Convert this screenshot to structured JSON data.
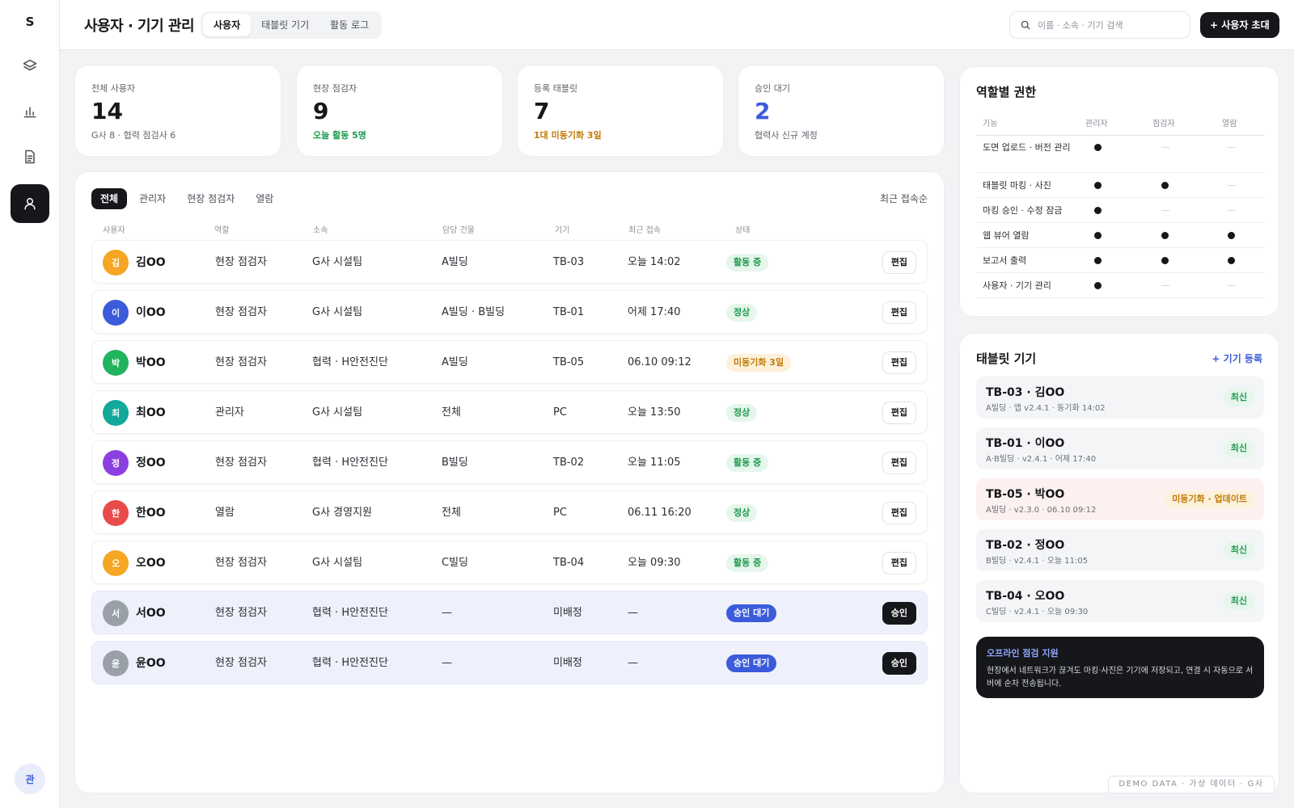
{
  "app": {
    "logo": "S",
    "user_initial": "관"
  },
  "header": {
    "title": "사용자 · 기기 관리",
    "tabs": [
      "사용자",
      "태블릿 기기",
      "활동 로그"
    ],
    "search_placeholder": "이름 · 소속 · 기기 검색",
    "invite_label": "+ 사용자 초대"
  },
  "stats": [
    {
      "label": "전체 사용자",
      "value": "14",
      "sub": "G사 8 · 협력 점검사 6",
      "value_color": "#15171a",
      "sub_color": "#5f646d"
    },
    {
      "label": "현장 점검자",
      "value": "9",
      "sub": "오늘 활동 5명",
      "value_color": "#15171a",
      "sub_color": "#1e9a4d"
    },
    {
      "label": "등록 태블릿",
      "value": "7",
      "sub": "1대 미동기화 3일",
      "value_color": "#15171a",
      "sub_color": "#c27a06"
    },
    {
      "label": "승인 대기",
      "value": "2",
      "sub": "협력사 신규 계정",
      "value_color": "#3b5bdb",
      "sub_color": "#5f646d"
    }
  ],
  "users": {
    "filter_tabs": [
      "전체",
      "관리자",
      "현장 점검자",
      "열람"
    ],
    "sort_label": "최근 접속순",
    "columns": [
      "사용자",
      "역할",
      "소속",
      "담당 건물",
      "기기",
      "최근 접속",
      "상태"
    ],
    "rows": [
      {
        "initial": "김",
        "name": "김OO",
        "role": "현장 점검자",
        "org": "G사 시설팀",
        "building": "A빌딩",
        "device": "TB-03",
        "last": "오늘 14:02",
        "status": "활동 중",
        "status_type": "active",
        "action": "편집",
        "avatar_color": "#f5a623",
        "pending": false
      },
      {
        "initial": "이",
        "name": "이OO",
        "role": "현장 점검자",
        "org": "G사 시설팀",
        "building": "A빌딩 · B빌딩",
        "device": "TB-01",
        "last": "어제 17:40",
        "status": "정상",
        "status_type": "ok",
        "action": "편집",
        "avatar_color": "#3b5bdb",
        "pending": false
      },
      {
        "initial": "박",
        "name": "박OO",
        "role": "현장 점검자",
        "org": "협력 · H안전진단",
        "building": "A빌딩",
        "device": "TB-05",
        "last": "06.10 09:12",
        "status": "미동기화 3일",
        "status_type": "warn",
        "action": "편집",
        "avatar_color": "#22b35e",
        "pending": false
      },
      {
        "initial": "최",
        "name": "최OO",
        "role": "관리자",
        "org": "G사 시설팀",
        "building": "전체",
        "device": "PC",
        "last": "오늘 13:50",
        "status": "정상",
        "status_type": "ok",
        "action": "편집",
        "avatar_color": "#12a89a",
        "pending": false
      },
      {
        "initial": "정",
        "name": "정OO",
        "role": "현장 점검자",
        "org": "협력 · H안전진단",
        "building": "B빌딩",
        "device": "TB-02",
        "last": "오늘 11:05",
        "status": "활동 중",
        "status_type": "active",
        "action": "편집",
        "avatar_color": "#8b3fe0",
        "pending": false
      },
      {
        "initial": "한",
        "name": "한OO",
        "role": "열람",
        "org": "G사 경영지원",
        "building": "전체",
        "device": "PC",
        "last": "06.11 16:20",
        "status": "정상",
        "status_type": "ok",
        "action": "편집",
        "avatar_color": "#e94a4a",
        "pending": false
      },
      {
        "initial": "오",
        "name": "오OO",
        "role": "현장 점검자",
        "org": "G사 시설팀",
        "building": "C빌딩",
        "device": "TB-04",
        "last": "오늘 09:30",
        "status": "활동 중",
        "status_type": "active",
        "action": "편집",
        "avatar_color": "#f5a623",
        "pending": false
      },
      {
        "initial": "서",
        "name": "서OO",
        "role": "현장 점검자",
        "org": "협력 · H안전진단",
        "building": "—",
        "device": "미배정",
        "last": "—",
        "status": "승인 대기",
        "status_type": "pending",
        "action": "승인",
        "avatar_color": "#9aa0a8",
        "pending": true
      },
      {
        "initial": "윤",
        "name": "윤OO",
        "role": "현장 점검자",
        "org": "협력 · H안전진단",
        "building": "—",
        "device": "미배정",
        "last": "—",
        "status": "승인 대기",
        "status_type": "pending",
        "action": "승인",
        "avatar_color": "#9aa0a8",
        "pending": true
      }
    ]
  },
  "permissions": {
    "title": "역할별 권한",
    "columns": [
      "기능",
      "관리자",
      "점검자",
      "열람"
    ],
    "rows": [
      {
        "label": "도면 업로드 · 버전 관리",
        "admin": true,
        "inspector": false,
        "viewer": false
      },
      {
        "label": "태블릿 마킹 · 사진",
        "admin": true,
        "inspector": true,
        "viewer": false
      },
      {
        "label": "마킹 승인 · 수정 잠금",
        "admin": true,
        "inspector": false,
        "viewer": false
      },
      {
        "label": "웹 뷰어 열람",
        "admin": true,
        "inspector": true,
        "viewer": true
      },
      {
        "label": "보고서 출력",
        "admin": true,
        "inspector": true,
        "viewer": true
      },
      {
        "label": "사용자 · 기기 관리",
        "admin": true,
        "inspector": false,
        "viewer": false
      }
    ]
  },
  "tablets": {
    "title": "태블릿 기기",
    "add_label": "+ 기기 등록",
    "devices": [
      {
        "title": "TB-03 · 김OO",
        "sub": "A빌딩 · 앱 v2.4.1 · 동기화 14:02",
        "badge": "최신",
        "warn": false
      },
      {
        "title": "TB-01 · 이OO",
        "sub": "A·B빌딩 · v2.4.1 · 어제 17:40",
        "badge": "최신",
        "warn": false
      },
      {
        "title": "TB-05 · 박OO",
        "sub": "A빌딩 · v2.3.0 · 06.10 09:12",
        "badge": "미동기화 · 업데이트",
        "warn": true
      },
      {
        "title": "TB-02 · 정OO",
        "sub": "B빌딩 · v2.4.1 · 오늘 11:05",
        "badge": "최신",
        "warn": false
      },
      {
        "title": "TB-04 · 오OO",
        "sub": "C빌딩 · v2.4.1 · 오늘 09:30",
        "badge": "최신",
        "warn": false
      }
    ],
    "offline_title": "오프라인 점검 지원",
    "offline_text": "현장에서 네트워크가 끊겨도 마킹·사진은 기기에 저장되고, 연결 시 자동으로 서버에 순차 전송됩니다."
  },
  "footer": {
    "demo_label": "DEMO DATA · 가상 데이터 · G사"
  }
}
